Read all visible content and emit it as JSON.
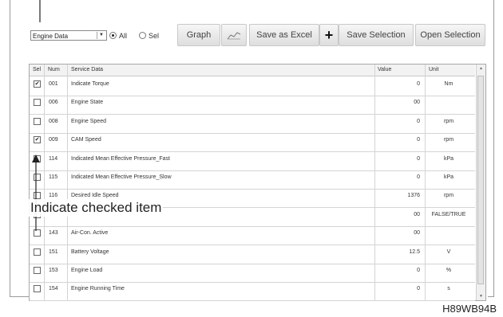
{
  "toolbar": {
    "dropdown_value": "Engine Data",
    "radio_all": "All",
    "radio_sel": "Sel",
    "graph_label": "Graph",
    "save_excel_label": "Save as Excel",
    "save_selection_label": "Save Selection",
    "open_selection_label": "Open Selection"
  },
  "grid": {
    "headers": {
      "sel": "Sel",
      "num": "Num",
      "service": "Service Data",
      "value": "Value",
      "unit": "Unit"
    },
    "rows": [
      {
        "checked": true,
        "num": "001",
        "name": "Indicate Torque",
        "value": "0",
        "unit": "Nm"
      },
      {
        "checked": false,
        "num": "006",
        "name": "Engine State",
        "value": "00",
        "unit": ""
      },
      {
        "checked": false,
        "num": "008",
        "name": "Engine Speed",
        "value": "0",
        "unit": "rpm"
      },
      {
        "checked": true,
        "num": "009",
        "name": "CAM Speed",
        "value": "0",
        "unit": "rpm"
      },
      {
        "checked": false,
        "num": "114",
        "name": "Indicated Mean Effective Pressure_Fast",
        "value": "0",
        "unit": "kPa"
      },
      {
        "checked": false,
        "num": "115",
        "name": "Indicated Mean Effective Pressure_Slow",
        "value": "0",
        "unit": "kPa"
      },
      {
        "checked": false,
        "num": "116",
        "name": "Desired Idle Speed",
        "value": "1376",
        "unit": "rpm"
      },
      {
        "checked": false,
        "num": "",
        "name": "",
        "value": "00",
        "unit": "FALSE/TRUE"
      },
      {
        "checked": false,
        "num": "143",
        "name": "Air-Con. Active",
        "value": "00",
        "unit": ""
      },
      {
        "checked": false,
        "num": "151",
        "name": "Battery Voltage",
        "value": "12.5",
        "unit": "V"
      },
      {
        "checked": false,
        "num": "153",
        "name": "Engine Load",
        "value": "0",
        "unit": "%"
      },
      {
        "checked": false,
        "num": "154",
        "name": "Engine Running Time",
        "value": "0",
        "unit": "s"
      }
    ]
  },
  "annotation": {
    "callout": "Indicate checked item",
    "figure_id": "H89WB94B"
  }
}
